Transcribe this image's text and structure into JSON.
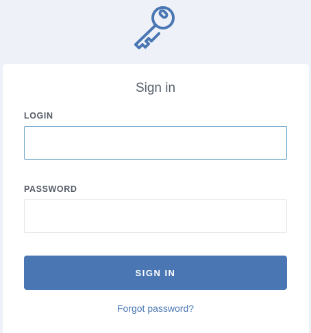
{
  "header": {
    "logo_icon": "key-icon",
    "logo_color": "#4a77b4"
  },
  "form": {
    "title": "Sign in",
    "login": {
      "label": "LOGIN",
      "value": "",
      "placeholder": ""
    },
    "password": {
      "label": "PASSWORD",
      "value": "",
      "placeholder": ""
    },
    "submit_label": "SIGN IN",
    "forgot_label": "Forgot password?"
  },
  "colors": {
    "accent": "#4a77b4",
    "page_background": "#eef1f7",
    "focused_input_border": "#6ea6c9"
  }
}
